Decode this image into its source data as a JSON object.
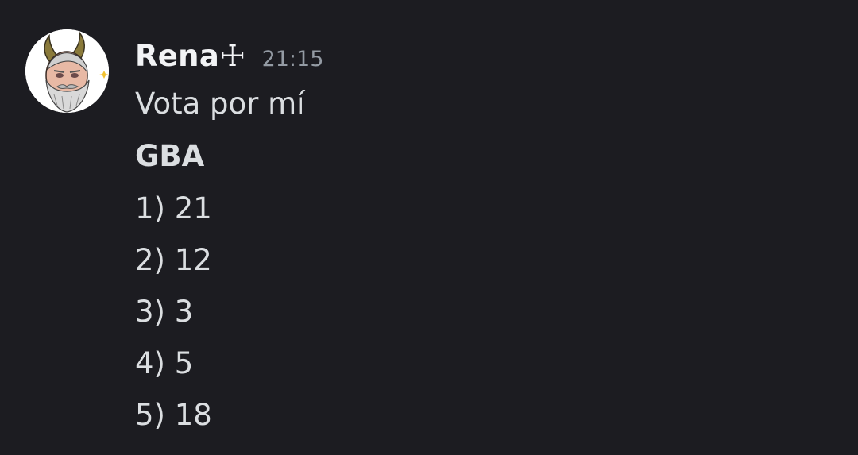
{
  "message": {
    "author": "Rena☩",
    "timestamp": "21:15",
    "avatar_icon": "bearded-horned-man-avatar",
    "lines": [
      "Vota por mí",
      "GBA",
      "1) 21",
      "2) 12",
      "3) 3",
      "4) 5",
      "5) 18"
    ]
  },
  "colors": {
    "background": "#1c1c21",
    "username": "#f2f3f5",
    "timestamp": "#949ba4",
    "text": "#dbdee1"
  }
}
